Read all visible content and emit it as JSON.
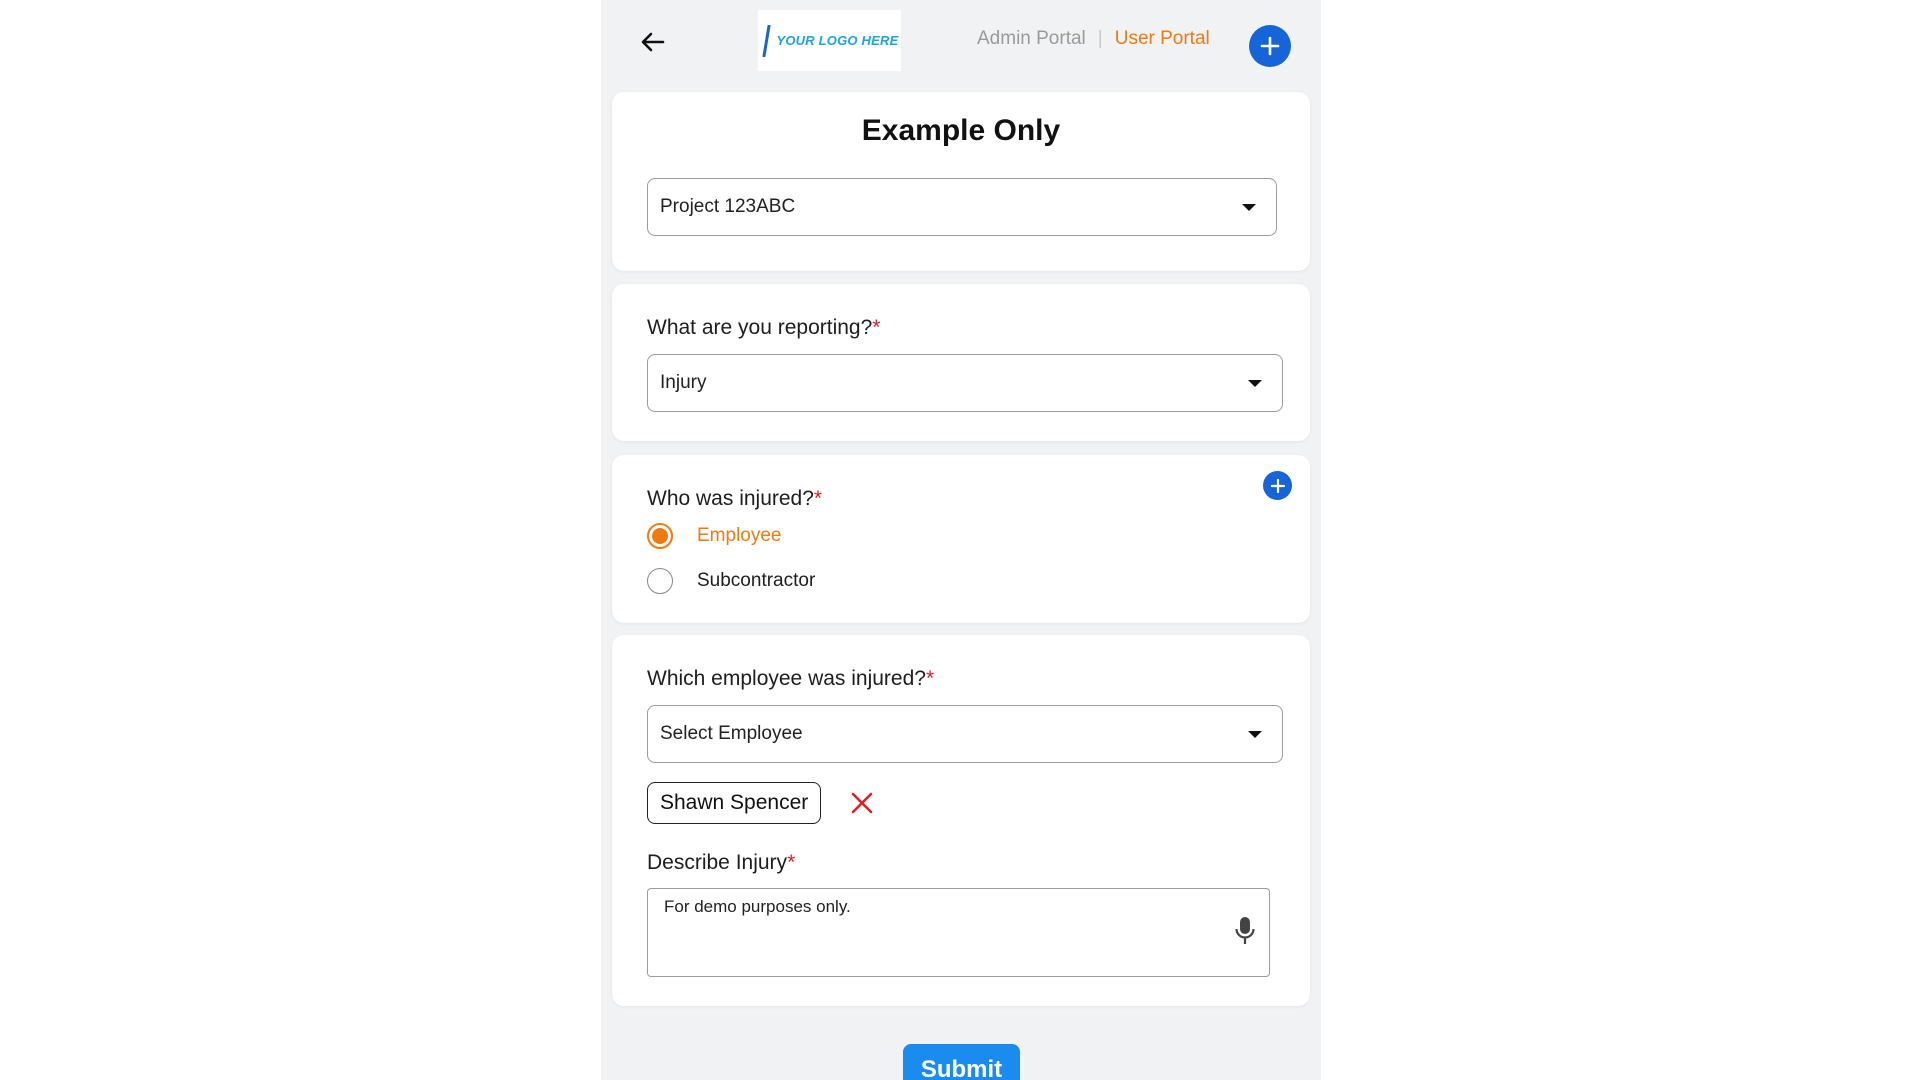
{
  "header": {
    "logo_text": "YOUR LOGO HERE",
    "admin_portal": "Admin Portal",
    "separator": "|",
    "user_portal": "User Portal"
  },
  "colors": {
    "accent_orange": "#ef7a12",
    "primary_blue": "#1565d8",
    "submit_blue": "#1a8cf0",
    "required_red": "#e02020"
  },
  "form": {
    "title": "Example Only",
    "project": {
      "selected": "Project 123ABC"
    },
    "reporting": {
      "label": "What are you reporting?",
      "required_mark": "*",
      "selected": "Injury"
    },
    "injured": {
      "label": "Who was injured?",
      "required_mark": "*",
      "options": [
        {
          "label": "Employee",
          "selected": true
        },
        {
          "label": "Subcontractor",
          "selected": false
        }
      ]
    },
    "employee": {
      "label": "Which employee was injured?",
      "required_mark": "*",
      "placeholder": "Select Employee",
      "chip": "Shawn Spencer"
    },
    "describe": {
      "label": "Describe Injury",
      "required_mark": "*",
      "value": "For demo purposes only."
    },
    "submit_label": "Submit"
  },
  "icons": {
    "back": "arrow-left-icon",
    "add": "plus-icon",
    "dropdown": "caret-down-icon",
    "remove": "close-icon",
    "mic": "microphone-icon"
  }
}
